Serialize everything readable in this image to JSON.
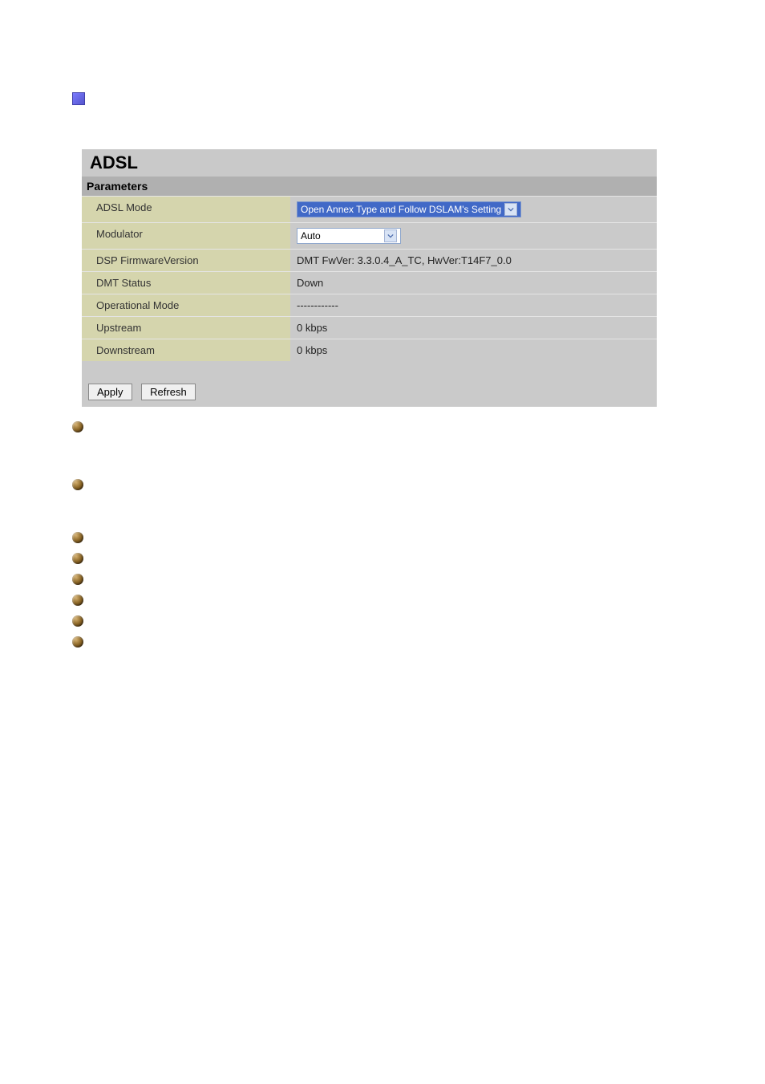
{
  "panel": {
    "title": "ADSL",
    "section_header": "Parameters",
    "rows": [
      {
        "label": "ADSL Mode",
        "value": "Open Annex Type and Follow DSLAM's Setting",
        "type": "select-wide"
      },
      {
        "label": "Modulator",
        "value": "Auto",
        "type": "select-narrow"
      },
      {
        "label": "DSP FirmwareVersion",
        "value": "DMT FwVer: 3.3.0.4_A_TC, HwVer:T14F7_0.0",
        "type": "text"
      },
      {
        "label": "DMT Status",
        "value": "Down",
        "type": "text"
      },
      {
        "label": "Operational Mode",
        "value": "------------",
        "type": "text"
      },
      {
        "label": "Upstream",
        "value": "0 kbps",
        "type": "text"
      },
      {
        "label": "Downstream",
        "value": "0 kbps",
        "type": "text"
      }
    ],
    "buttons": {
      "apply": "Apply",
      "refresh": "Refresh"
    }
  }
}
